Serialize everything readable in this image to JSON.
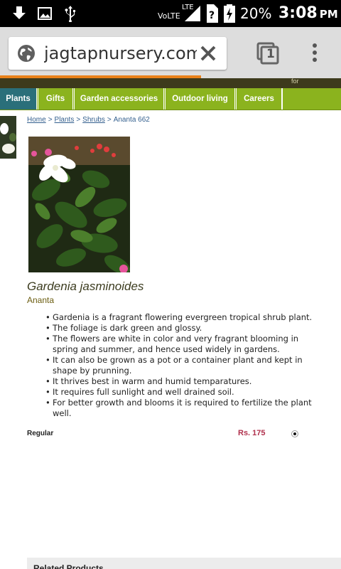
{
  "status_bar": {
    "network": "VoLTE",
    "network_type": "LTE",
    "battery": "20%",
    "time": "3:08",
    "time_suffix": "PM",
    "icons": [
      "download-icon",
      "image-icon",
      "usb-icon",
      "signal-icon",
      "unknown-sim-icon",
      "battery-charging-icon"
    ]
  },
  "browser": {
    "url": "jagtapnursery.com",
    "tab_count": "1",
    "progress": 0.59
  },
  "site": {
    "top_text": "for",
    "nav": [
      "Plants",
      "Gifts",
      "Garden accessories",
      "Outdoor living",
      "Careers"
    ]
  },
  "breadcrumb": {
    "items": [
      "Home",
      "Plants",
      "Shrubs"
    ],
    "current": "Ananta 662",
    "separator": ">"
  },
  "product": {
    "title": "Gardenia jasminoides",
    "subtitle": "Ananta",
    "bullets": [
      "Gardenia is a fragrant flowering evergreen tropical shrub plant.",
      "The foliage is dark green and glossy.",
      "The flowers are white in color and very fragrant blooming in spring and summer, and hence used widely in gardens.",
      "It can also be grown as a pot or a container plant and kept in shape by prunning.",
      "It thrives best in warm and humid temparatures.",
      "It requires full sunlight and well drained soil.",
      "For better growth and blooms it is required to fertilize the plant well."
    ]
  },
  "pricing": {
    "variant": "Regular",
    "price": "Rs. 175"
  },
  "related": {
    "title": "Related Products"
  },
  "colors": {
    "nav_green": "#8bb31e",
    "nav_active": "#2a6f7a",
    "price": "#b0304c",
    "progress": "#e8811a"
  }
}
